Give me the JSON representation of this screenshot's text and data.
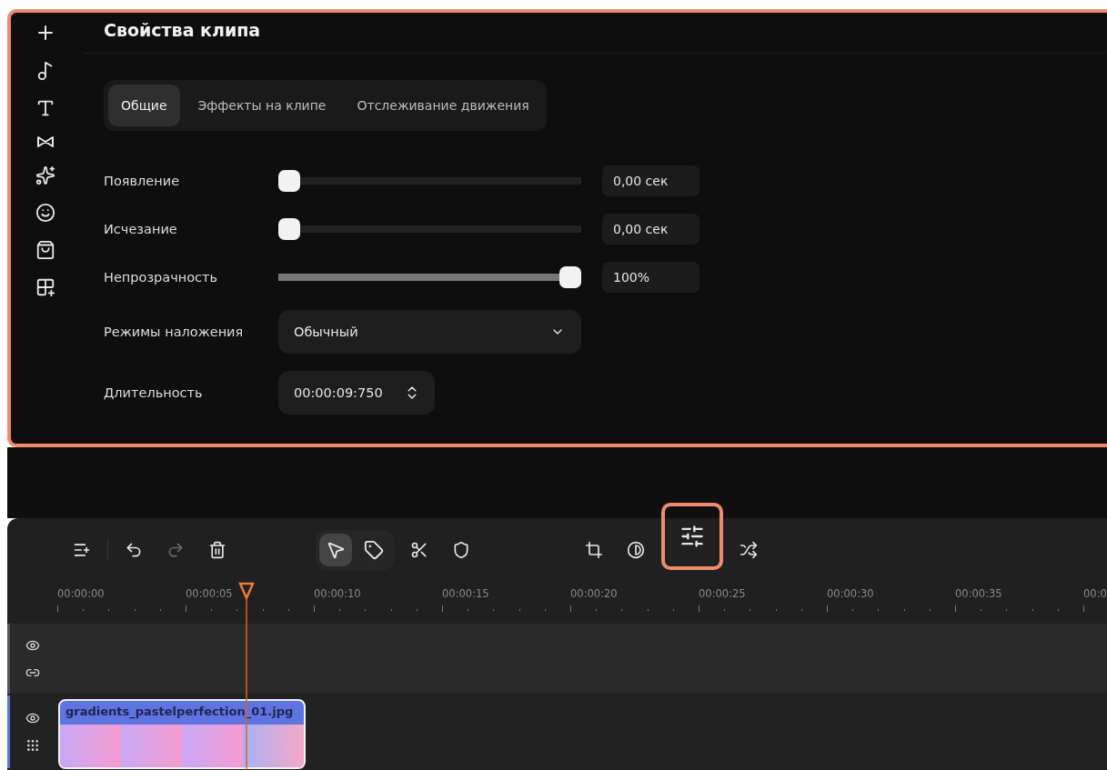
{
  "panel": {
    "title": "Свойства клипа",
    "highlighted": true
  },
  "tabs": [
    {
      "label": "Общие",
      "selected": true
    },
    {
      "label": "Эффекты на клипе",
      "selected": false
    },
    {
      "label": "Отслеживание движения",
      "selected": false
    }
  ],
  "properties": [
    {
      "kind": "slider",
      "label": "Появление",
      "level": 0,
      "value": "0,00 сек"
    },
    {
      "kind": "slider",
      "label": "Исчезание",
      "level": 0,
      "value": "0,00 сек"
    },
    {
      "kind": "slider",
      "label": "Непрозрачность",
      "level": 1,
      "value": "100%"
    },
    {
      "kind": "select",
      "label": "Режимы наложения",
      "value": "Обычный"
    },
    {
      "kind": "spinner",
      "label": "Длительность",
      "value": "00:00:09:750"
    }
  ],
  "toolbar": [
    [
      {
        "kind": "add-track",
        "disabled": false,
        "highlighted": false
      }
    ],
    [
      {
        "kind": "undo",
        "disabled": false,
        "highlighted": false
      },
      {
        "kind": "redo",
        "disabled": true,
        "highlighted": false
      },
      {
        "kind": "delete",
        "disabled": false,
        "highlighted": false
      }
    ],
    [
      {
        "kind": "modes",
        "disabled": false,
        "highlighted": false
      },
      {
        "kind": "cut",
        "disabled": false,
        "highlighted": false
      },
      {
        "kind": "shield",
        "disabled": false,
        "highlighted": false
      }
    ],
    [
      {
        "kind": "crop",
        "disabled": false,
        "highlighted": false
      },
      {
        "kind": "contrast",
        "disabled": false,
        "highlighted": false
      },
      {
        "kind": "adjust",
        "disabled": false,
        "highlighted": true
      },
      {
        "kind": "effects",
        "disabled": false,
        "highlighted": false
      }
    ]
  ],
  "tool_modes": [
    {
      "kind": "pointer",
      "selected": true
    },
    {
      "kind": "tag",
      "selected": false
    }
  ],
  "ruler": [
    "00:00:00",
    "00:00:05",
    "00:00:10",
    "00:00:15",
    "00:00:20",
    "00:00:25",
    "00:00:30",
    "00:00:35",
    "00:0"
  ],
  "tracks": [
    {
      "kind": "empty"
    },
    {
      "kind": "video",
      "clip": {
        "name": "gradients_pastelperfection_01.jpg",
        "selected": true
      }
    }
  ]
}
